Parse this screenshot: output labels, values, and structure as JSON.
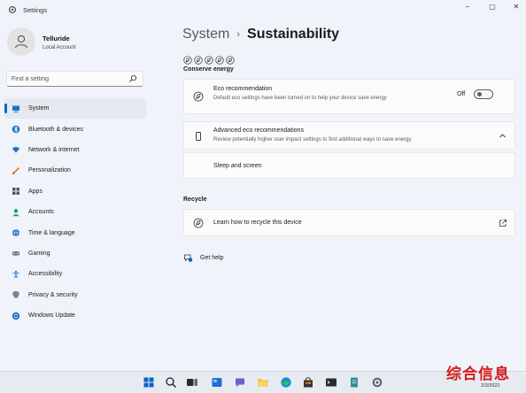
{
  "window": {
    "title": "Settings",
    "controls": {
      "minimize": "–",
      "maximize": "▢",
      "close": "✕"
    }
  },
  "profile": {
    "name": "Telluride",
    "account_type": "Local Account"
  },
  "search": {
    "placeholder": "Find a setting"
  },
  "sidebar": {
    "items": [
      {
        "label": "System",
        "icon": "system-icon",
        "active": true
      },
      {
        "label": "Bluetooth & devices",
        "icon": "bluetooth-icon"
      },
      {
        "label": "Network & internet",
        "icon": "wifi-icon"
      },
      {
        "label": "Personalization",
        "icon": "brush-icon"
      },
      {
        "label": "Apps",
        "icon": "apps-icon"
      },
      {
        "label": "Accounts",
        "icon": "accounts-icon"
      },
      {
        "label": "Time & language",
        "icon": "globe-icon"
      },
      {
        "label": "Gaming",
        "icon": "gamepad-icon"
      },
      {
        "label": "Accessibility",
        "icon": "accessibility-icon"
      },
      {
        "label": "Privacy & security",
        "icon": "shield-icon"
      },
      {
        "label": "Windows Update",
        "icon": "update-icon"
      }
    ]
  },
  "breadcrumb": {
    "parent": "System",
    "separator": "›",
    "current": "Sustainability"
  },
  "conserve": {
    "heading": "Conserve energy",
    "eco": {
      "title": "Eco recommendation",
      "description": "Default eco settings have been turned on to help your device save energy",
      "toggle_state": "Off",
      "toggle_on": false
    },
    "advanced": {
      "title": "Advanced eco recommendations",
      "description": "Review potentially higher user impact settings to find additional ways to save energy",
      "expanded": true,
      "sub_item": "Sleep and screen"
    }
  },
  "recycle": {
    "heading": "Recycle",
    "link_label": "Learn how to recycle this device"
  },
  "help": {
    "label": "Get help"
  },
  "taskbar": {
    "icons": [
      "start-icon",
      "search-icon",
      "task-view-icon",
      "widgets-icon",
      "chat-icon",
      "file-explorer-icon",
      "edge-icon",
      "store-icon",
      "terminal-icon",
      "notepad-icon",
      "settings-icon"
    ],
    "date": "2/3/2022"
  },
  "watermark": "综合信息",
  "colors": {
    "accent": "#0067c0",
    "background": "#f0f3f9",
    "card": "#fbfbfc",
    "watermark": "#d41a1a"
  }
}
